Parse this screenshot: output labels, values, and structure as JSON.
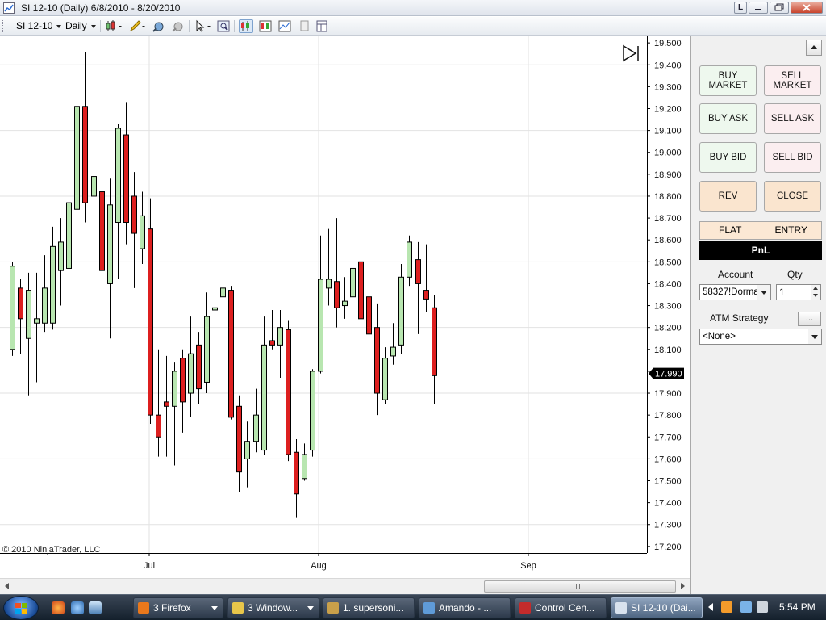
{
  "window": {
    "title": "SI 12-10 (Daily)  6/8/2010 - 8/20/2010",
    "buttons": {
      "l": "L",
      "min": "",
      "max": "",
      "close": ""
    }
  },
  "toolbar": {
    "instrument": "SI 12-10",
    "interval": "Daily"
  },
  "chart": {
    "copyright": "© 2010 NinjaTrader, LLC",
    "current_price_label": "17.990",
    "colors": {
      "up": "#b8e6b0",
      "down": "#dd1f1f",
      "wick": "#000000",
      "grid": "#e2e2e2",
      "price_tag": "#000000"
    }
  },
  "chart_data": {
    "type": "candlestick",
    "y_tick_labels": [
      "19.500",
      "19.400",
      "19.300",
      "19.200",
      "19.100",
      "19.000",
      "18.900",
      "18.800",
      "18.700",
      "18.600",
      "18.500",
      "18.400",
      "18.300",
      "18.200",
      "18.100",
      "18.000",
      "17.900",
      "17.800",
      "17.700",
      "17.600",
      "17.500",
      "17.400",
      "17.300",
      "17.200"
    ],
    "ylim": [
      17.17,
      19.53
    ],
    "x_tick_labels": [
      "Jul",
      "Aug",
      "Sep"
    ],
    "current_price": 17.99,
    "candles": [
      {
        "o": 18.1,
        "h": 18.5,
        "l": 18.07,
        "c": 18.48
      },
      {
        "o": 18.38,
        "h": 18.42,
        "l": 18.08,
        "c": 18.24
      },
      {
        "o": 18.15,
        "h": 18.45,
        "l": 17.89,
        "c": 18.37
      },
      {
        "o": 18.22,
        "h": 18.45,
        "l": 17.95,
        "c": 18.24
      },
      {
        "o": 18.22,
        "h": 18.53,
        "l": 18.18,
        "c": 18.38
      },
      {
        "o": 18.22,
        "h": 18.66,
        "l": 18.19,
        "c": 18.57
      },
      {
        "o": 18.46,
        "h": 18.7,
        "l": 18.3,
        "c": 18.59
      },
      {
        "o": 18.47,
        "h": 18.87,
        "l": 18.4,
        "c": 18.77
      },
      {
        "o": 18.74,
        "h": 19.28,
        "l": 18.67,
        "c": 19.21
      },
      {
        "o": 19.21,
        "h": 19.46,
        "l": 18.68,
        "c": 18.77
      },
      {
        "o": 18.8,
        "h": 18.99,
        "l": 18.4,
        "c": 18.89
      },
      {
        "o": 18.82,
        "h": 18.95,
        "l": 18.2,
        "c": 18.46
      },
      {
        "o": 18.4,
        "h": 18.88,
        "l": 18.15,
        "c": 18.76
      },
      {
        "o": 18.68,
        "h": 19.13,
        "l": 18.42,
        "c": 19.11
      },
      {
        "o": 19.08,
        "h": 19.23,
        "l": 18.58,
        "c": 18.68
      },
      {
        "o": 18.8,
        "h": 18.91,
        "l": 18.38,
        "c": 18.63
      },
      {
        "o": 18.56,
        "h": 18.82,
        "l": 18.49,
        "c": 18.71
      },
      {
        "o": 18.65,
        "h": 18.79,
        "l": 17.76,
        "c": 17.8
      },
      {
        "o": 17.8,
        "h": 18.1,
        "l": 17.61,
        "c": 17.7
      },
      {
        "o": 17.86,
        "h": 18.07,
        "l": 17.61,
        "c": 17.84
      },
      {
        "o": 17.84,
        "h": 18.04,
        "l": 17.57,
        "c": 18.0
      },
      {
        "o": 18.06,
        "h": 18.1,
        "l": 17.72,
        "c": 17.86
      },
      {
        "o": 17.9,
        "h": 18.25,
        "l": 17.79,
        "c": 18.08
      },
      {
        "o": 18.12,
        "h": 18.18,
        "l": 17.85,
        "c": 17.92
      },
      {
        "o": 17.95,
        "h": 18.36,
        "l": 17.9,
        "c": 18.25
      },
      {
        "o": 18.28,
        "h": 18.31,
        "l": 18.2,
        "c": 18.29
      },
      {
        "o": 18.34,
        "h": 18.47,
        "l": 18.16,
        "c": 18.38
      },
      {
        "o": 18.37,
        "h": 18.39,
        "l": 17.78,
        "c": 17.79
      },
      {
        "o": 17.84,
        "h": 17.89,
        "l": 17.45,
        "c": 17.54
      },
      {
        "o": 17.6,
        "h": 17.77,
        "l": 17.47,
        "c": 17.68
      },
      {
        "o": 17.68,
        "h": 17.92,
        "l": 17.63,
        "c": 17.8
      },
      {
        "o": 17.64,
        "h": 18.25,
        "l": 17.62,
        "c": 18.12
      },
      {
        "o": 18.14,
        "h": 18.28,
        "l": 18.1,
        "c": 18.12
      },
      {
        "o": 18.12,
        "h": 18.28,
        "l": 17.97,
        "c": 18.2
      },
      {
        "o": 18.19,
        "h": 18.23,
        "l": 17.59,
        "c": 17.62
      },
      {
        "o": 17.63,
        "h": 17.69,
        "l": 17.33,
        "c": 17.44
      },
      {
        "o": 17.51,
        "h": 17.67,
        "l": 17.5,
        "c": 17.62
      },
      {
        "o": 17.64,
        "h": 18.01,
        "l": 17.61,
        "c": 18.0
      },
      {
        "o": 18.0,
        "h": 18.62,
        "l": 17.99,
        "c": 18.42
      },
      {
        "o": 18.38,
        "h": 18.65,
        "l": 18.3,
        "c": 18.42
      },
      {
        "o": 18.41,
        "h": 18.7,
        "l": 18.2,
        "c": 18.29
      },
      {
        "o": 18.3,
        "h": 18.43,
        "l": 18.24,
        "c": 18.32
      },
      {
        "o": 18.34,
        "h": 18.6,
        "l": 18.25,
        "c": 18.47
      },
      {
        "o": 18.5,
        "h": 18.59,
        "l": 18.15,
        "c": 18.24
      },
      {
        "o": 18.34,
        "h": 18.48,
        "l": 18.03,
        "c": 18.17
      },
      {
        "o": 18.2,
        "h": 18.31,
        "l": 17.8,
        "c": 17.9
      },
      {
        "o": 17.87,
        "h": 18.11,
        "l": 17.85,
        "c": 18.06
      },
      {
        "o": 18.07,
        "h": 18.22,
        "l": 18.03,
        "c": 18.11
      },
      {
        "o": 18.12,
        "h": 18.49,
        "l": 18.08,
        "c": 18.43
      },
      {
        "o": 18.43,
        "h": 18.62,
        "l": 18.39,
        "c": 18.59
      },
      {
        "o": 18.51,
        "h": 18.59,
        "l": 18.17,
        "c": 18.4
      },
      {
        "o": 18.37,
        "h": 18.58,
        "l": 18.27,
        "c": 18.33
      },
      {
        "o": 18.29,
        "h": 18.35,
        "l": 17.85,
        "c": 17.98
      }
    ]
  },
  "order_panel": {
    "buy_market": "BUY MARKET",
    "sell_market": "SELL MARKET",
    "buy_ask": "BUY ASK",
    "sell_ask": "SELL ASK",
    "buy_bid": "BUY BID",
    "sell_bid": "SELL BID",
    "rev": "REV",
    "close": "CLOSE",
    "flat": "FLAT",
    "entry": "ENTRY",
    "pnl": "PnL",
    "account_label": "Account",
    "qty_label": "Qty",
    "account_value": "58327!Dorman",
    "qty_value": "1",
    "atm_label": "ATM Strategy",
    "atm_button": "...",
    "atm_value": "<None>"
  },
  "taskbar": {
    "tasks": [
      {
        "label": "3 Firefox",
        "color": "#e9781c"
      },
      {
        "label": "3 Window...",
        "color": "#e8c64a"
      },
      {
        "label": "1. supersoni...",
        "color": "#c9a04a"
      },
      {
        "label": "Amando - ...",
        "color": "#5f9bd8"
      },
      {
        "label": "Control Cen...",
        "color": "#c42b2b"
      },
      {
        "label": "SI 12-10 (Dai...",
        "color": "#d8e2ee"
      }
    ],
    "clock": "5:54 PM"
  }
}
